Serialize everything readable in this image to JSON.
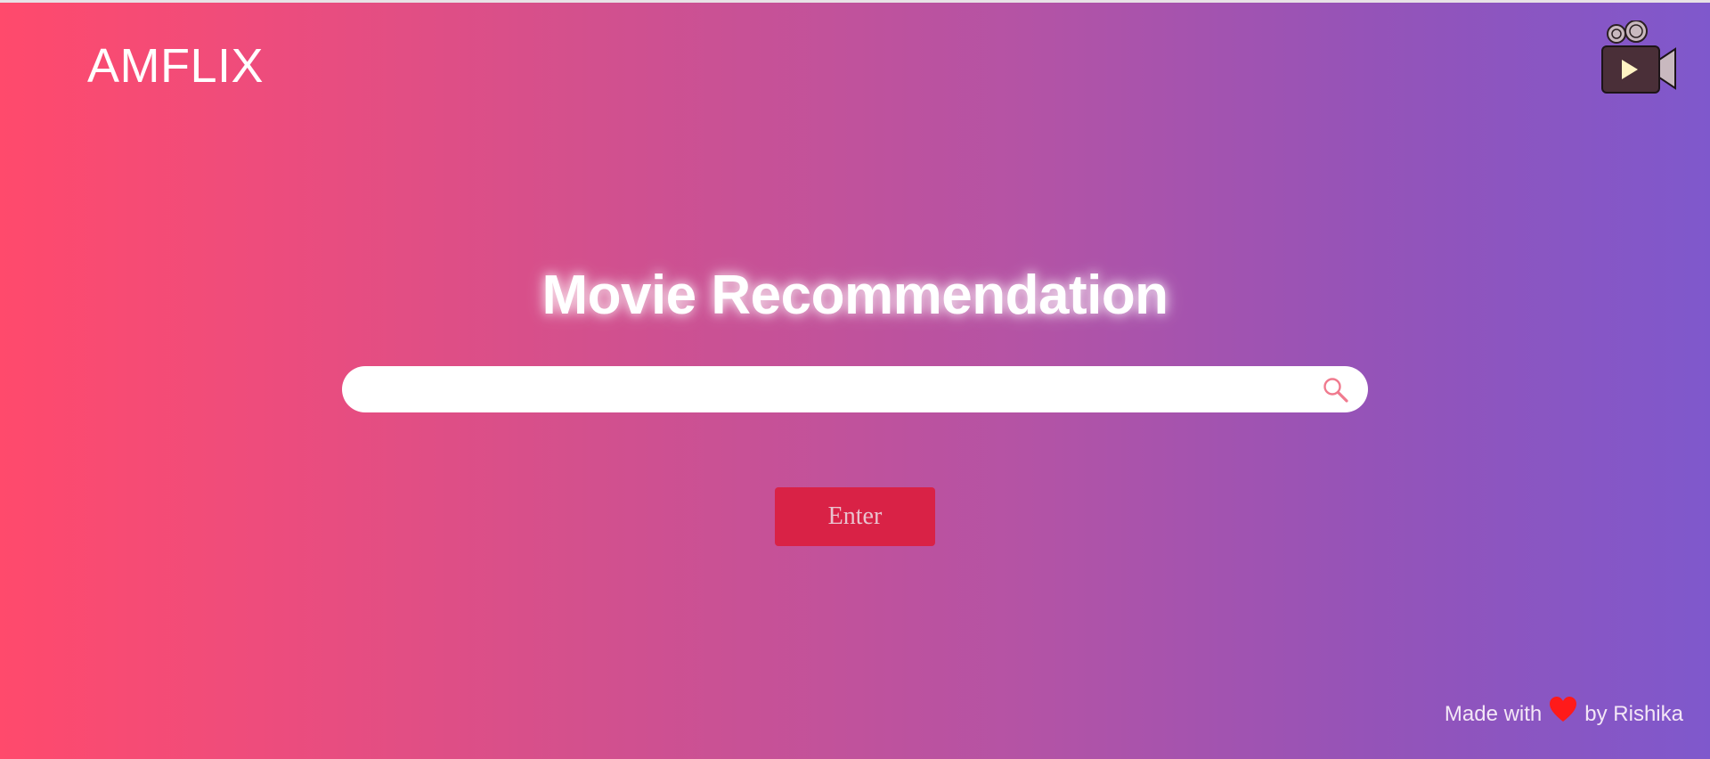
{
  "brand": {
    "name": "AMFLIX",
    "logo_icon": "movie-camera-icon"
  },
  "hero": {
    "title": "Movie Recommendation"
  },
  "search": {
    "value": "",
    "placeholder": "",
    "icon": "search-icon"
  },
  "actions": {
    "enter_label": "Enter"
  },
  "footer": {
    "prefix": "Made with",
    "icon": "heart-icon",
    "suffix": "by Rishika"
  },
  "colors": {
    "gradient_start": "#ff4a6c",
    "gradient_end": "#7f58cc",
    "button": "#d92246",
    "heart": "#ff1a1a",
    "search_icon": "#f07a8e"
  }
}
